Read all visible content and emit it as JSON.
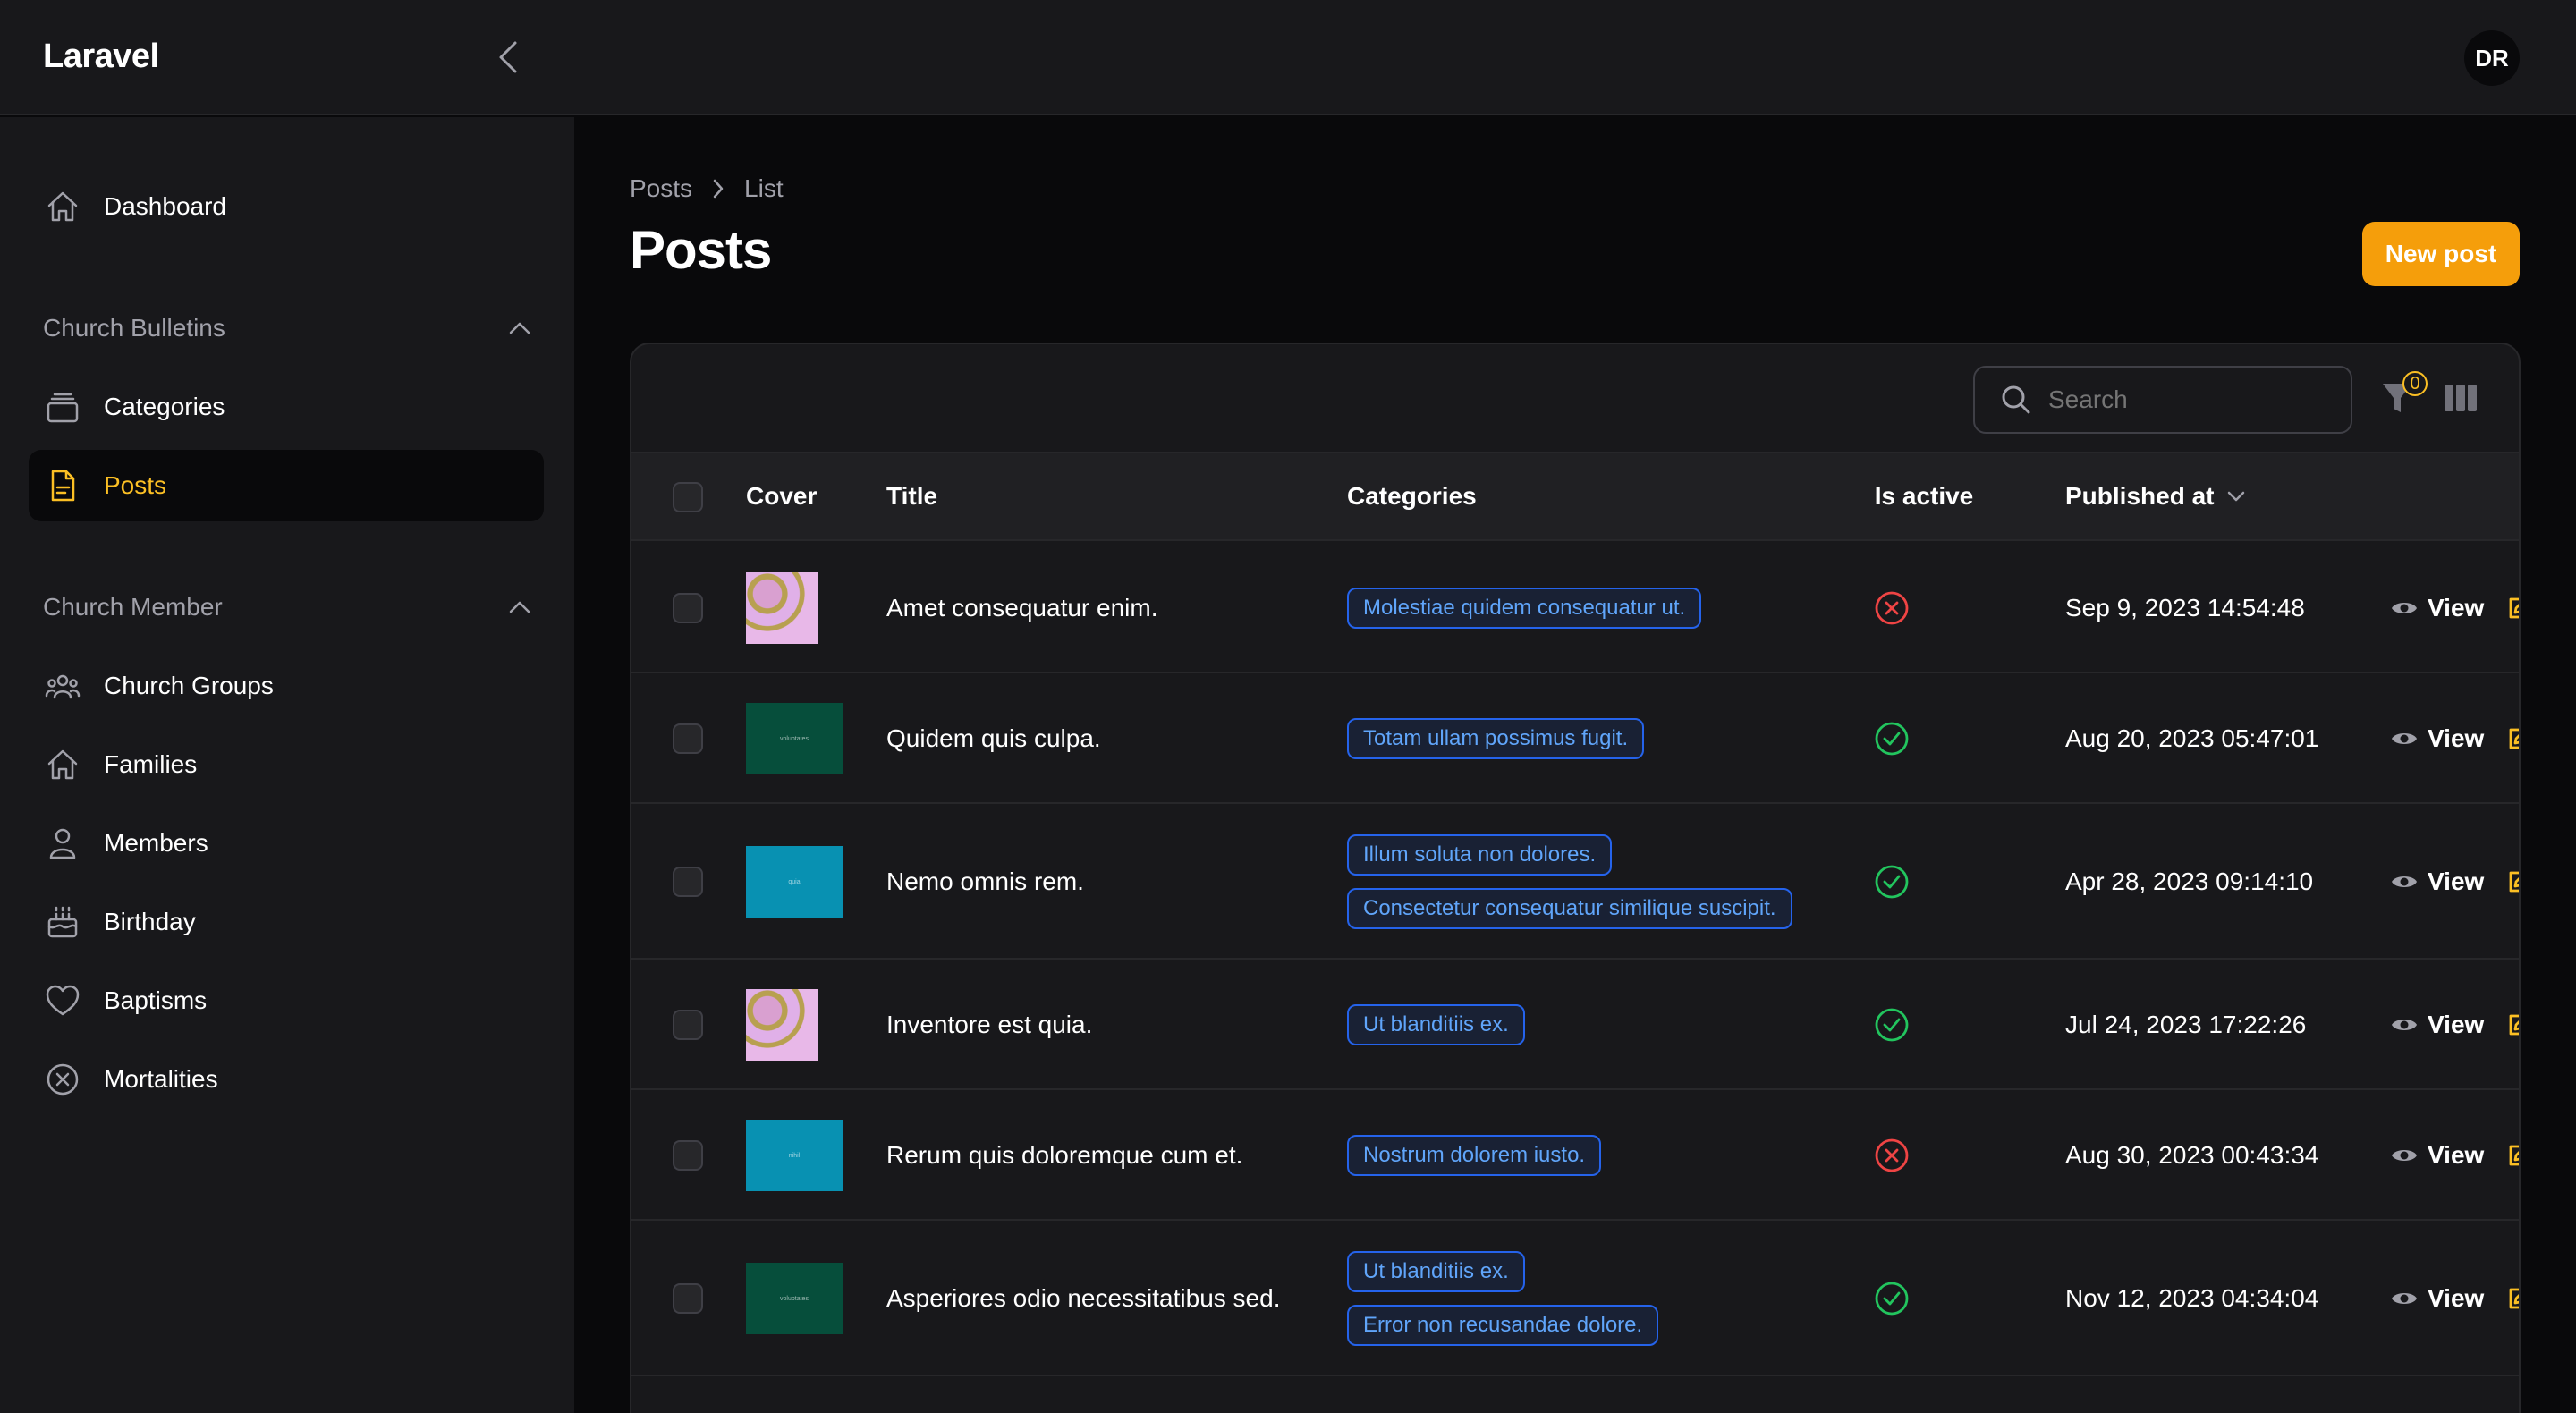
{
  "app": {
    "name": "Laravel",
    "user_initials": "DR"
  },
  "sidebar": {
    "dashboard": "Dashboard",
    "groups": [
      {
        "label": "Church Bulletins",
        "items": [
          "Categories",
          "Posts"
        ]
      },
      {
        "label": "Church Member",
        "items": [
          "Church Groups",
          "Families",
          "Members",
          "Birthday",
          "Baptisms",
          "Mortalities"
        ]
      }
    ],
    "active_item": "Posts"
  },
  "breadcrumbs": [
    "Posts",
    "List"
  ],
  "page": {
    "title": "Posts",
    "new_button": "New post"
  },
  "table": {
    "search_placeholder": "Search",
    "filter_count": "0",
    "columns": [
      "Cover",
      "Title",
      "Categories",
      "Is active",
      "Published at"
    ],
    "action_view": "View",
    "action_edit": "Edit",
    "rows": [
      {
        "cover": "pink",
        "cover_text": "",
        "title": "Amet consequatur enim.",
        "categories": [
          "Molestiae quidem consequatur ut."
        ],
        "active": false,
        "published": "Sep 9, 2023 14:54:48"
      },
      {
        "cover": "green",
        "cover_text": "voluptates",
        "title": "Quidem quis culpa.",
        "categories": [
          "Totam ullam possimus fugit."
        ],
        "active": true,
        "published": "Aug 20, 2023 05:47:01"
      },
      {
        "cover": "teal",
        "cover_text": "quia",
        "title": "Nemo omnis rem.",
        "categories": [
          "Illum soluta non dolores.",
          "Consectetur consequatur similique suscipit."
        ],
        "active": true,
        "published": "Apr 28, 2023 09:14:10"
      },
      {
        "cover": "pink",
        "cover_text": "",
        "title": "Inventore est quia.",
        "categories": [
          "Ut blanditiis ex."
        ],
        "active": true,
        "published": "Jul 24, 2023 17:22:26"
      },
      {
        "cover": "teal",
        "cover_text": "nihil",
        "title": "Rerum quis doloremque cum et.",
        "categories": [
          "Nostrum dolorem iusto."
        ],
        "active": false,
        "published": "Aug 30, 2023 00:43:34"
      },
      {
        "cover": "green",
        "cover_text": "voluptates",
        "title": "Asperiores odio necessitatibus sed.",
        "categories": [
          "Ut blanditiis ex.",
          "Error non recusandae dolore."
        ],
        "active": true,
        "published": "Nov 12, 2023 04:34:04"
      }
    ]
  },
  "colors": {
    "accent": "#f59e0b",
    "active_text": "#fbbf24",
    "badge_blue": "#60a5fa",
    "success": "#22c55e",
    "danger": "#ef4444"
  }
}
